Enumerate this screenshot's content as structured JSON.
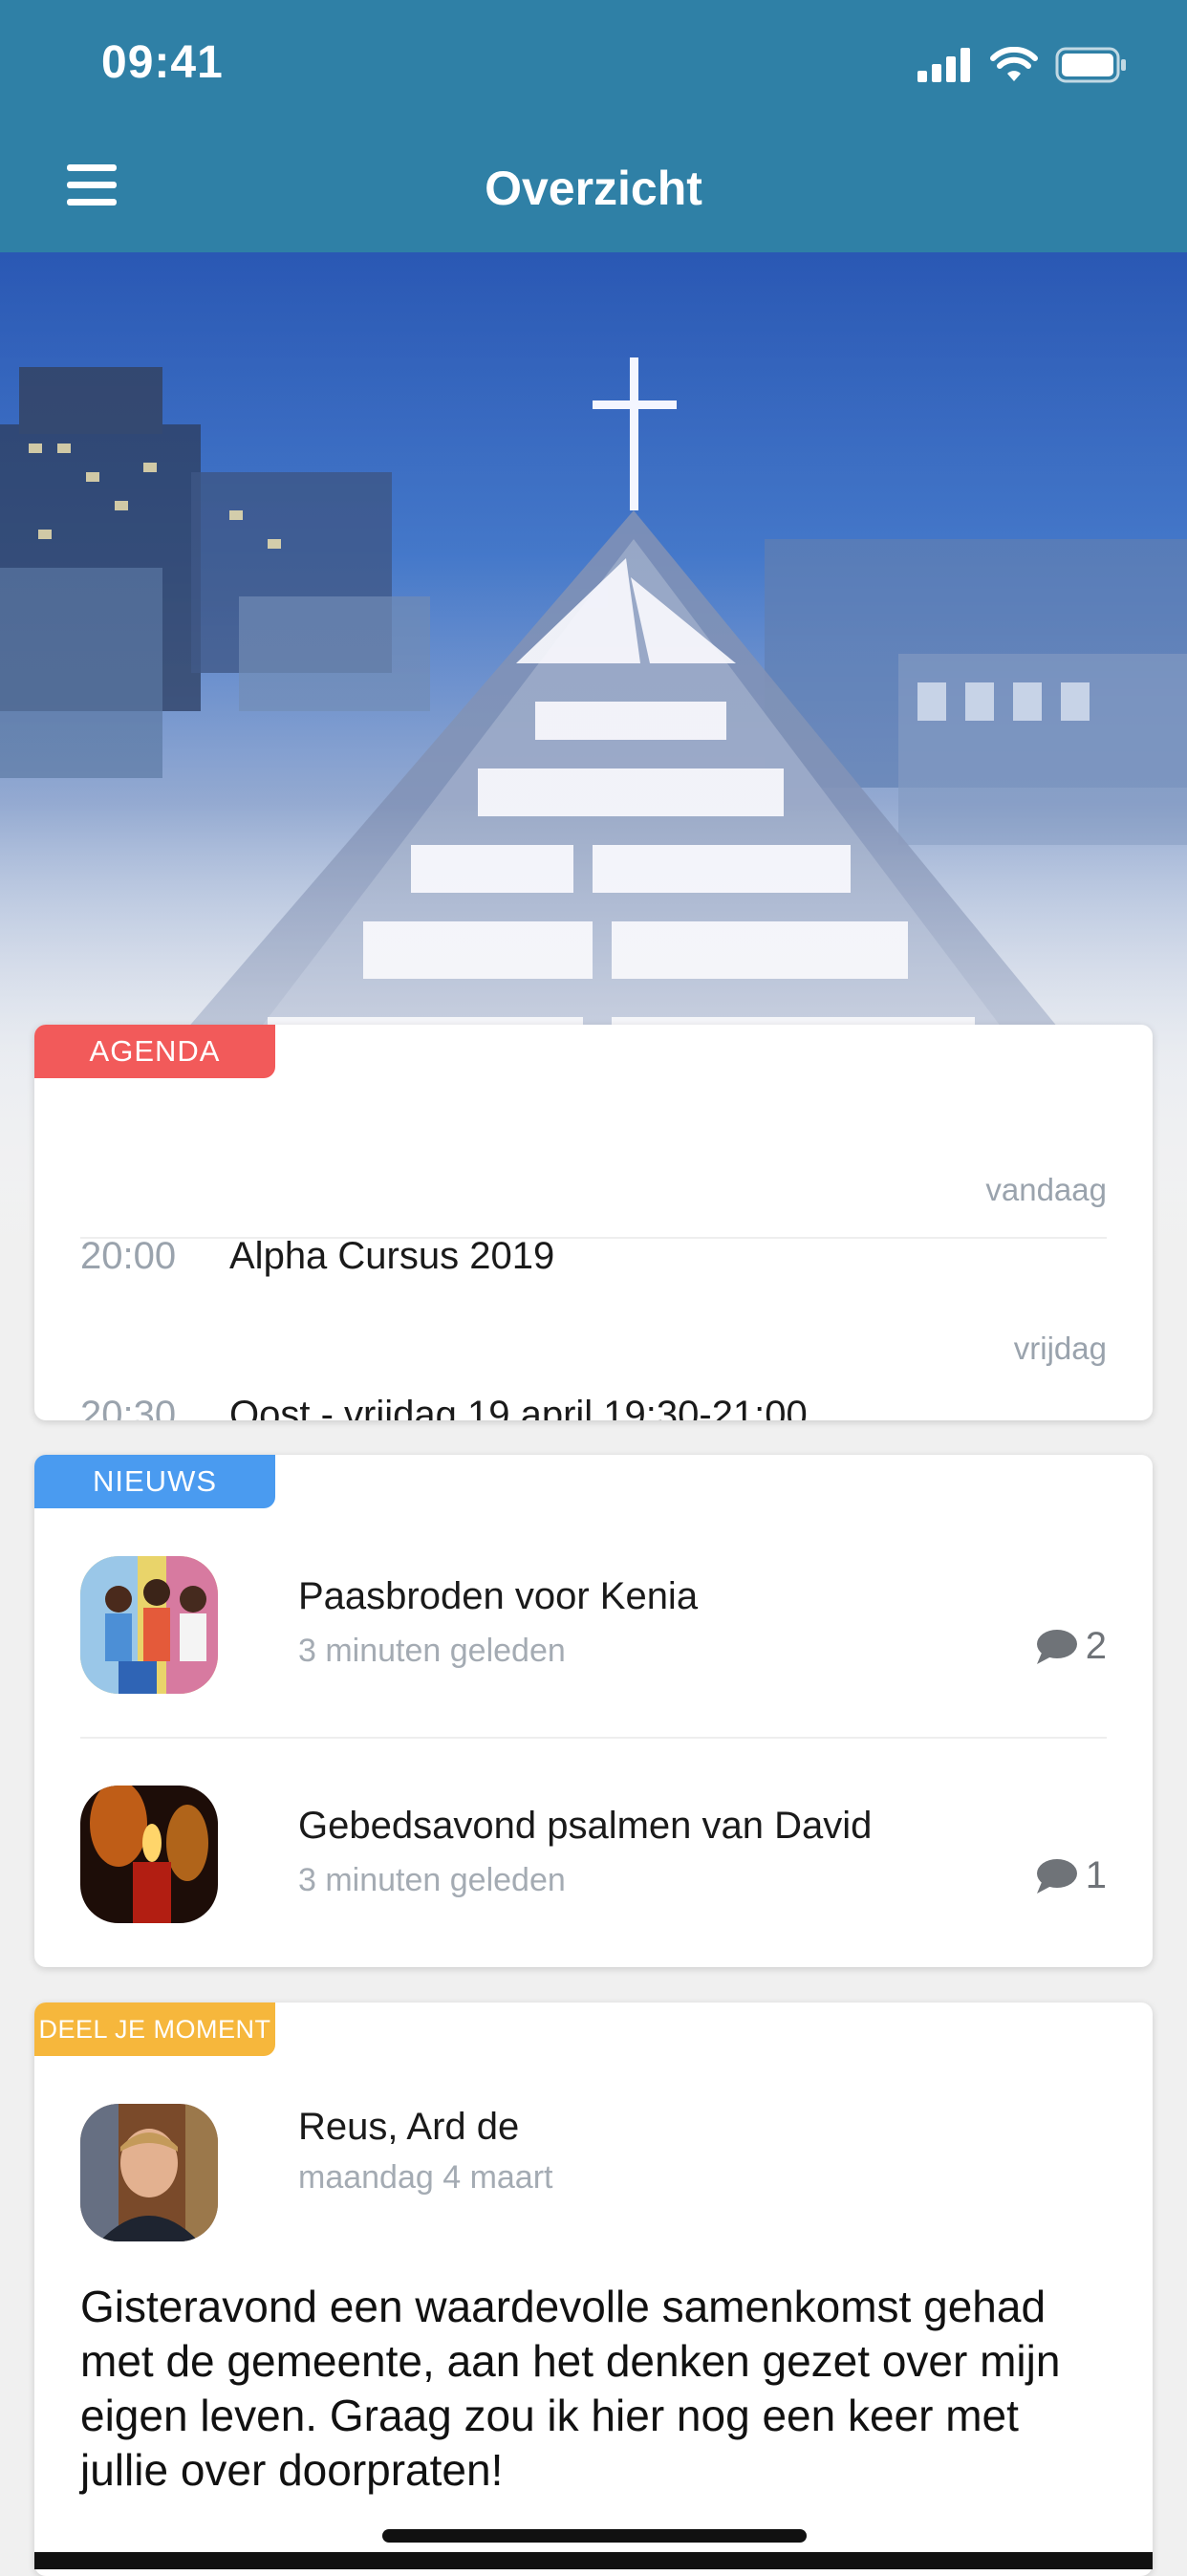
{
  "status_bar": {
    "time": "09:41"
  },
  "header": {
    "title": "Overzicht"
  },
  "agenda": {
    "tag": "AGENDA",
    "tag_color": "#f25a5a",
    "events": [
      {
        "day": "vandaag",
        "time": "20:00",
        "title": "Alpha Cursus 2019"
      },
      {
        "day": "vrijdag",
        "time": "20:30",
        "title": "Oost - vrijdag 19 april 19:30-21:00"
      }
    ]
  },
  "news": {
    "tag": "NIEUWS",
    "tag_color": "#4a9bf0",
    "items": [
      {
        "title": "Paasbroden voor Kenia",
        "subtitle": "3 minuten geleden",
        "comments": "2"
      },
      {
        "title": "Gebedsavond psalmen van David",
        "subtitle": "3 minuten geleden",
        "comments": "1"
      }
    ]
  },
  "moment": {
    "tag": "DEEL JE MOMENT",
    "tag_color": "#f6b73c",
    "author": "Reus, Ard de",
    "date": "maandag 4 maart",
    "text": "Gisteravond een waardevolle samenkomst gehad met de gemeente, aan het denken gezet over mijn eigen leven. Graag zou ik hier nog een keer met jullie over doorpraten!"
  },
  "colors": {
    "header": "#2f80a6",
    "background": "#f0f0f0"
  }
}
